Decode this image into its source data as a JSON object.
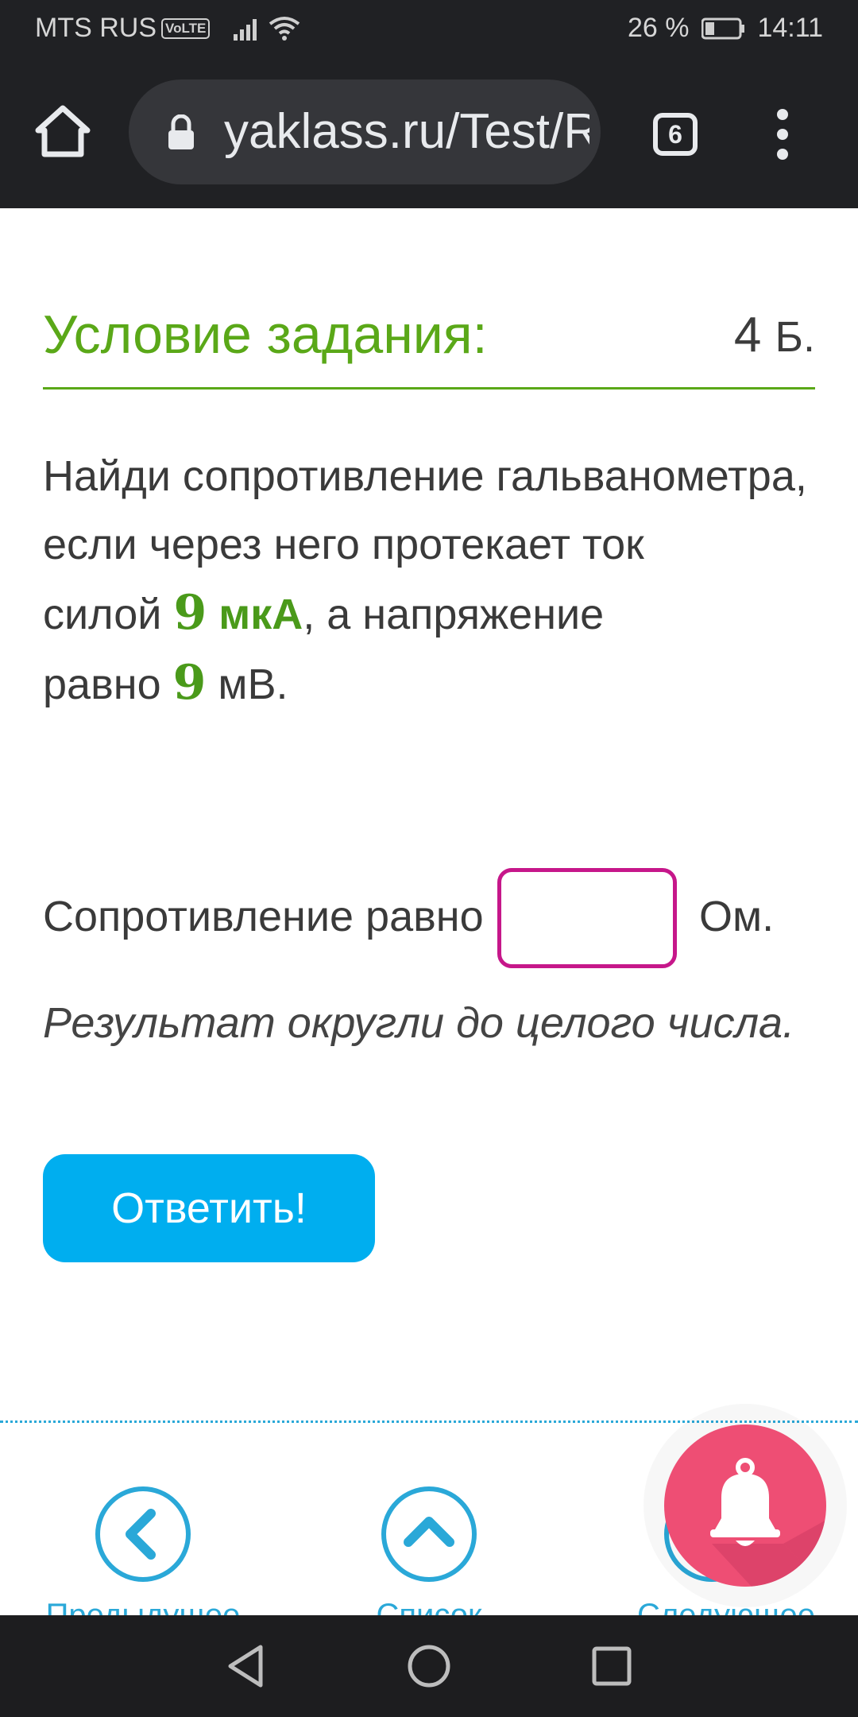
{
  "status_bar": {
    "carrier": "MTS RUS",
    "volte": "VoLTE",
    "battery": "26 %",
    "time": "14:11"
  },
  "browser": {
    "url": "yaklass.ru/Test/Run",
    "tab_count": "6"
  },
  "task": {
    "title": "Условие задания:",
    "points_value": "4",
    "points_unit": "Б.",
    "text_line1": "Найди сопротивление гальванометра,",
    "text_line2": "если через него протекает ток",
    "text_line3_pre": "силой ",
    "current_value": "9",
    "current_unit": "мкА",
    "text_line3_post": ", а напряжение",
    "text_line4_pre": "равно ",
    "voltage_value": "9",
    "voltage_unit": "мВ."
  },
  "answer": {
    "label": "Сопротивление равно",
    "value": "",
    "unit": "Ом.",
    "hint": "Результат округли до целого числа."
  },
  "submit_label": "Ответить!",
  "bottom_nav": {
    "prev_label": "Предыдущее",
    "list_label": "Список",
    "next_label": "Следующее"
  },
  "colors": {
    "green_accent": "#5aa818",
    "button_blue": "#00aeef",
    "input_border": "#c6178a",
    "bell_pink": "#ee4e74"
  }
}
